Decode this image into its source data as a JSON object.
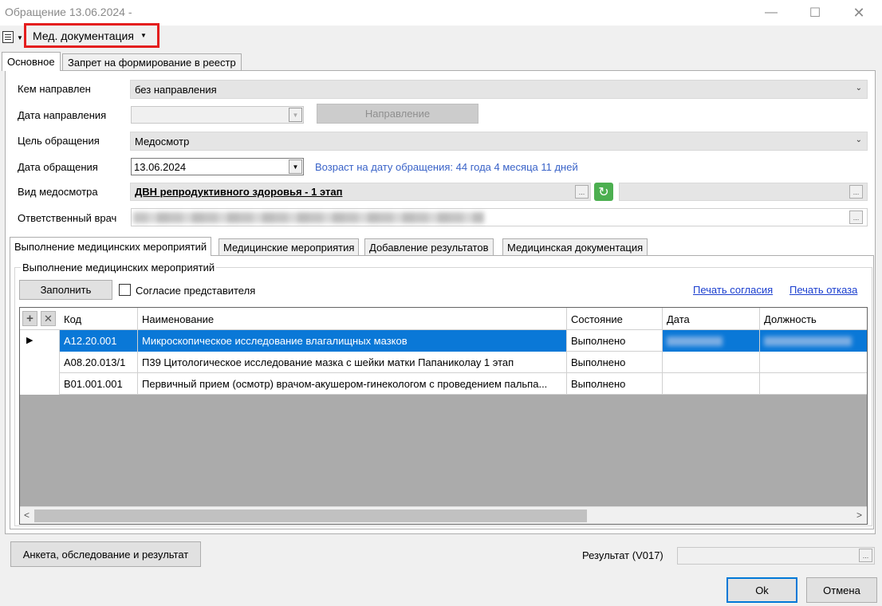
{
  "window": {
    "title": "Обращение 13.06.2024 -",
    "minimize": "—",
    "maximize": "☐",
    "close": "✕"
  },
  "menu": {
    "docs_label": "Мед. документация",
    "arrow": "▼"
  },
  "tabs": [
    "Основное",
    "Запрет на формирование в реестр"
  ],
  "form": {
    "referred_by_label": "Кем направлен",
    "referred_by_value": "без направления",
    "referral_date_label": "Дата направления",
    "referral_date_value": "",
    "referral_button": "Направление",
    "purpose_label": "Цель обращения",
    "purpose_value": "Медосмотр",
    "visit_date_label": "Дата обращения",
    "visit_date_value": "13.06.2024",
    "age_text": "Возраст на дату обращения: 44 года 4 месяца 11 дней",
    "exam_type_label": "Вид медосмотра",
    "exam_type_value": "ДВН репродуктивного здоровья - 1 этап",
    "doctor_label": "Ответственный врач",
    "ellipsis": "..."
  },
  "inner_tabs": [
    "Выполнение медицинских мероприятий",
    "Медицинские мероприятия",
    "Добавление результатов",
    "Медицинская документация"
  ],
  "group": {
    "title": "Выполнение медицинских мероприятий",
    "fill_button": "Заполнить",
    "consent_label": "Согласие представителя",
    "print_consent": "Печать согласия",
    "print_refusal": "Печать отказа"
  },
  "grid": {
    "columns": [
      "Код",
      "Наименование",
      "Состояние",
      "Дата",
      "Должность"
    ],
    "add_icon": "+",
    "delete_icon": "✕",
    "row_marker": "▶",
    "rows": [
      {
        "code": "A12.20.001",
        "name": "Микроскопическое исследование влагалищных мазков",
        "status": "Выполнено"
      },
      {
        "code": "A08.20.013/1",
        "name": "П39 Цитологическое исследование мазка с шейки матки Папаниколау  1 этап",
        "status": "Выполнено"
      },
      {
        "code": "B01.001.001",
        "name": "Первичный прием (осмотр) врачом-акушером-гинекологом с проведением пальпа...",
        "status": "Выполнено"
      }
    ],
    "scroll_left": "<",
    "scroll_right": ">"
  },
  "bottom": {
    "survey_button": "Анкета, обследование и результат",
    "result_label": "Результат (V017)",
    "ok": "Ok",
    "cancel": "Отмена"
  }
}
